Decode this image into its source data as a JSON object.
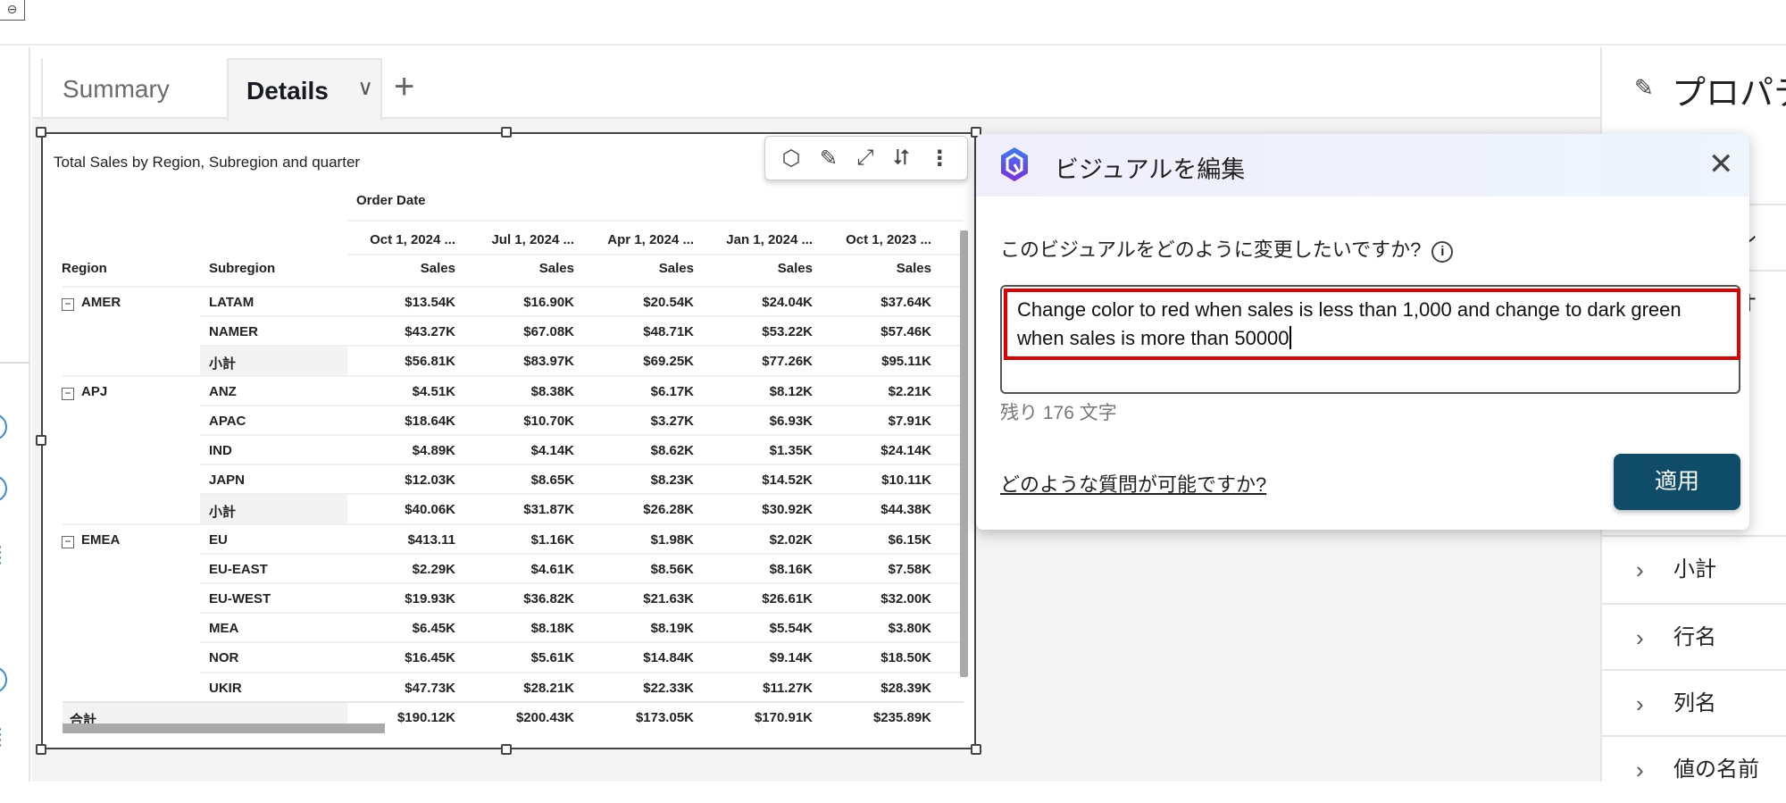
{
  "topbar": {
    "link_icon": "link-icon"
  },
  "tabs": [
    {
      "label": "Summary"
    },
    {
      "label": "Details",
      "active": true
    }
  ],
  "tab_add_label": "+",
  "visual": {
    "title": "Total Sales by Region, Subregion and quarter",
    "toolbar_icons": [
      "q-icon",
      "format-visual-icon",
      "expand-icon",
      "swap-icon",
      "more-icon"
    ],
    "column_group_header": "Order Date",
    "row_headers": [
      "Region",
      "Subregion"
    ],
    "date_columns": [
      "Oct 1, 2024 ...",
      "Jul 1, 2024 ...",
      "Apr 1, 2024 ...",
      "Jan 1, 2024 ...",
      "Oct 1, 2023 ..."
    ],
    "measure_label": "Sales",
    "rows": [
      {
        "region": "AMER",
        "subregion": "LATAM",
        "values": [
          "$13.54K",
          "$16.90K",
          "$20.54K",
          "$24.04K",
          "$37.64K"
        ]
      },
      {
        "region": "",
        "subregion": "NAMER",
        "values": [
          "$43.27K",
          "$67.08K",
          "$48.71K",
          "$53.22K",
          "$57.46K"
        ]
      },
      {
        "region": "",
        "subregion": "小計",
        "subtotal": true,
        "values": [
          "$56.81K",
          "$83.97K",
          "$69.25K",
          "$77.26K",
          "$95.11K"
        ]
      },
      {
        "region": "APJ",
        "subregion": "ANZ",
        "values": [
          "$4.51K",
          "$8.38K",
          "$6.17K",
          "$8.12K",
          "$2.21K"
        ]
      },
      {
        "region": "",
        "subregion": "APAC",
        "values": [
          "$18.64K",
          "$10.70K",
          "$3.27K",
          "$6.93K",
          "$7.91K"
        ]
      },
      {
        "region": "",
        "subregion": "IND",
        "values": [
          "$4.89K",
          "$4.14K",
          "$8.62K",
          "$1.35K",
          "$24.14K"
        ]
      },
      {
        "region": "",
        "subregion": "JAPN",
        "values": [
          "$12.03K",
          "$8.65K",
          "$8.23K",
          "$14.52K",
          "$10.11K"
        ]
      },
      {
        "region": "",
        "subregion": "小計",
        "subtotal": true,
        "values": [
          "$40.06K",
          "$31.87K",
          "$26.28K",
          "$30.92K",
          "$44.38K"
        ]
      },
      {
        "region": "EMEA",
        "subregion": "EU",
        "values": [
          "$413.11",
          "$1.16K",
          "$1.98K",
          "$2.02K",
          "$6.15K"
        ]
      },
      {
        "region": "",
        "subregion": "EU-EAST",
        "values": [
          "$2.29K",
          "$4.61K",
          "$8.56K",
          "$8.16K",
          "$7.58K"
        ]
      },
      {
        "region": "",
        "subregion": "EU-WEST",
        "values": [
          "$19.93K",
          "$36.82K",
          "$21.63K",
          "$26.61K",
          "$32.00K"
        ]
      },
      {
        "region": "",
        "subregion": "MEA",
        "values": [
          "$6.45K",
          "$8.18K",
          "$8.19K",
          "$5.54K",
          "$3.80K"
        ]
      },
      {
        "region": "",
        "subregion": "NOR",
        "values": [
          "$16.45K",
          "$5.61K",
          "$14.84K",
          "$9.14K",
          "$18.50K"
        ]
      },
      {
        "region": "",
        "subregion": "UKIR",
        "values": [
          "$47.73K",
          "$28.21K",
          "$22.33K",
          "$11.27K",
          "$28.39K"
        ]
      }
    ],
    "total": {
      "label": "合計",
      "values": [
        "$190.12K",
        "$200.43K",
        "$173.05K",
        "$170.91K",
        "$235.89K"
      ]
    }
  },
  "properties_panel": {
    "title": "プロパティ",
    "partial_items": [
      "レ",
      "オ"
    ],
    "items": [
      "小計",
      "行名",
      "列名",
      "値の名前"
    ]
  },
  "edit_visual_popup": {
    "title": "ビジュアルを編集",
    "question": "このビジュアルをどのように変更したいですか?",
    "input_value": "Change color to red when sales is less than 1,000 and change to dark green when sales is more than 50000",
    "remaining": "残り 176 文字",
    "help_link": "どのような質問が可能ですか?",
    "apply_label": "適用",
    "colors": {
      "apply_button": "#0f4c68",
      "highlight_box": "#e00000"
    }
  }
}
